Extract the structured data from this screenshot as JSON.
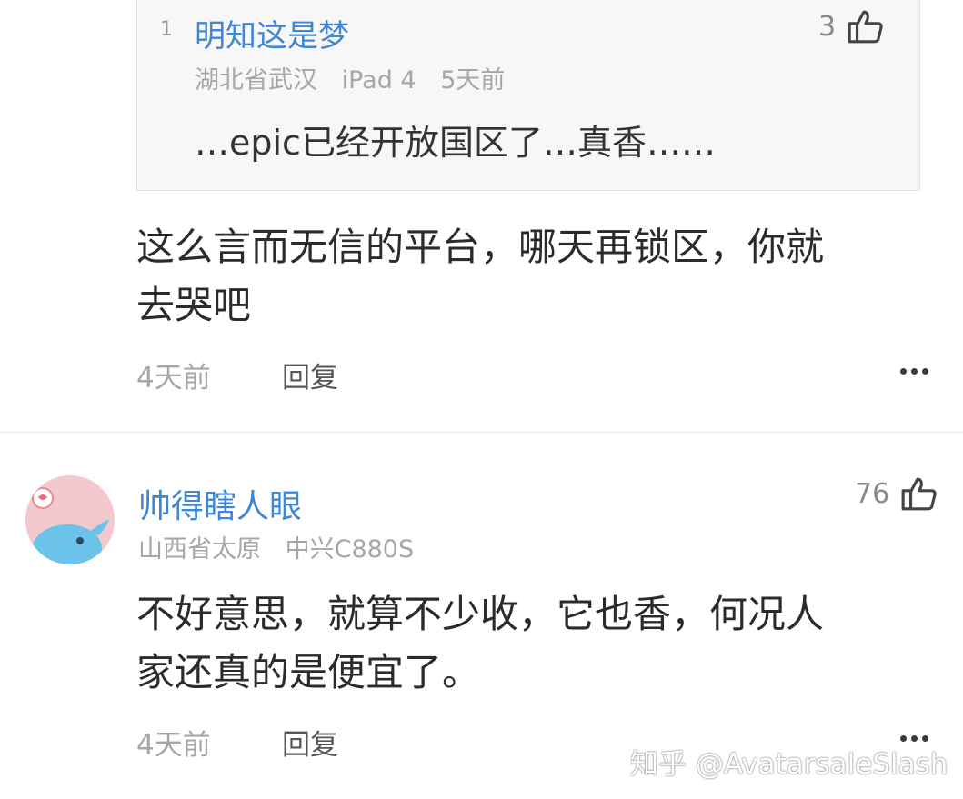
{
  "quoted_comment": {
    "index": "1",
    "author": "明知这是梦",
    "location": "湖北省武汉",
    "device": "iPad 4",
    "time": "5天前",
    "text": "…epic已经开放国区了…真香……",
    "likes": "3",
    "like_icon": "thumbs-up-icon"
  },
  "reply_comment": {
    "text_line1": "这么言而无信的平台，哪天再锁区，你就",
    "text_line2": "去哭吧",
    "time": "4天前",
    "reply_label": "回复",
    "more_icon": "more-dots-icon"
  },
  "comment2": {
    "author": "帅得瞎人眼",
    "location": "山西省太原",
    "device": "中兴C880S",
    "likes": "76",
    "like_icon": "thumbs-up-icon",
    "text_line1": "不好意思，就算不少收，它也香，何况人",
    "text_line2": "家还真的是便宜了。",
    "time": "4天前",
    "reply_label": "回复",
    "more_icon": "more-dots-icon"
  },
  "watermark": "知乎 @AvatarsaleSlash",
  "colors": {
    "accent_blue": "#3f87d4",
    "meta_gray": "#a6a6a6",
    "quote_bg": "#f7f7f7"
  }
}
